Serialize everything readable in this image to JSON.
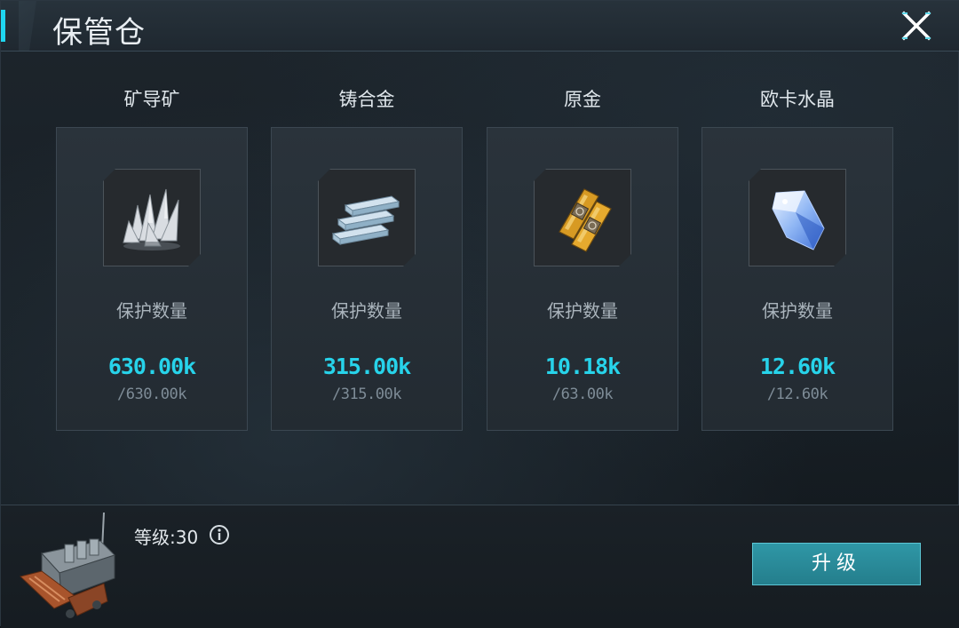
{
  "window": {
    "title": "保管仓",
    "close_icon": "close-icon",
    "accent_color": "#1fd6f0"
  },
  "resources": [
    {
      "name": "矿导矿",
      "icon": "crystal-ore-icon",
      "protect_label": "保护数量",
      "current": "630.00k",
      "max": "/630.00k"
    },
    {
      "name": "铸合金",
      "icon": "alloy-ingots-icon",
      "protect_label": "保护数量",
      "current": "315.00k",
      "max": "/315.00k"
    },
    {
      "name": "原金",
      "icon": "gold-bars-icon",
      "protect_label": "保护数量",
      "current": "10.18k",
      "max": "/63.00k"
    },
    {
      "name": "欧卡水晶",
      "icon": "blue-crystal-icon",
      "protect_label": "保护数量",
      "current": "12.60k",
      "max": "/12.60k"
    }
  ],
  "footer": {
    "level_text": "等级:30",
    "info_icon": "info-icon",
    "upgrade_label": "升级",
    "building_icon": "warehouse-ship-icon"
  },
  "colors": {
    "quantity": "#27d3ea",
    "button": "#2a8a98"
  }
}
